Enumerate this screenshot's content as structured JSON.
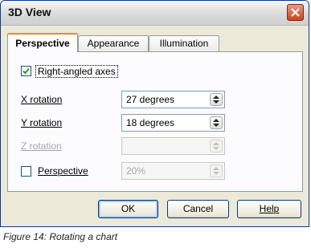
{
  "window": {
    "title": "3D View"
  },
  "tabs": [
    {
      "label": "Perspective",
      "active": true
    },
    {
      "label": "Appearance",
      "active": false
    },
    {
      "label": "Illumination",
      "active": false
    }
  ],
  "right_angled_axes": {
    "label": "Right-angled axes",
    "checked": true
  },
  "x_rotation": {
    "label": "X rotation",
    "value": "27 degrees"
  },
  "y_rotation": {
    "label": "Y rotation",
    "value": "18 degrees"
  },
  "z_rotation": {
    "label": "Z rotation",
    "value": "",
    "disabled": true
  },
  "perspective": {
    "label": "Perspective",
    "checked": false,
    "value": "20%",
    "disabled": true
  },
  "buttons": {
    "ok": "OK",
    "cancel": "Cancel",
    "help": "Help"
  },
  "caption": "Figure 14: Rotating a chart",
  "colors": {
    "active_tab_accent": "#e68b2c",
    "check_mark": "#21a121",
    "dialog_bg": "#ece9d8"
  }
}
